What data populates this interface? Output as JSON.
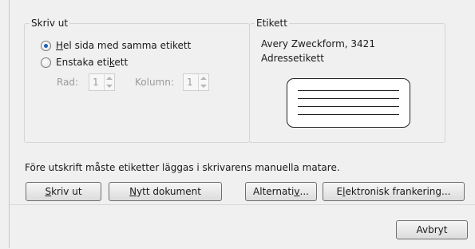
{
  "print_group": {
    "legend": "Skriv ut",
    "radio_full_page": {
      "mn": "H",
      "rest": "el sida med samma etikett",
      "checked": true
    },
    "radio_single": {
      "pre": "Enstaka eti",
      "mn": "k",
      "post": "ett",
      "checked": false
    },
    "row_label": "Rad:",
    "row_value": "1",
    "column_label": "Kolumn:",
    "column_value": "1"
  },
  "label_group": {
    "legend": "Etikett",
    "product": "Avery Zweckform, 3421",
    "type": "Adressetikett"
  },
  "notice": "Före utskrift måste etiketter läggas i skrivarens manuella matare.",
  "buttons": {
    "print": {
      "mn": "S",
      "rest": "kriv ut"
    },
    "new_document": {
      "mn": "N",
      "rest": "ytt dokument"
    },
    "options": {
      "pre": "Alternati",
      "mn": "v",
      "post": "..."
    },
    "electronic_postage": {
      "pre": "E",
      "mn": "l",
      "post": "ektronisk frankering..."
    },
    "cancel": "Avbryt"
  }
}
